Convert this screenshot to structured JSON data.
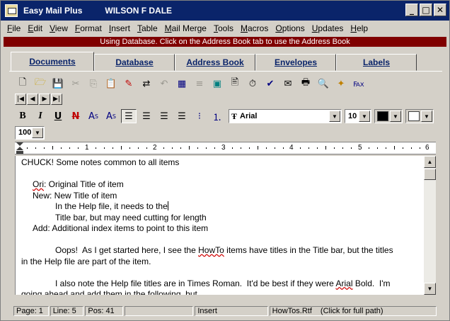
{
  "titlebar": {
    "app_title": "Easy Mail Plus",
    "user_name": "WILSON F DALE",
    "min_label": "_",
    "max_label": "□",
    "close_label": "✕"
  },
  "menu": [
    "File",
    "Edit",
    "View",
    "Format",
    "Insert",
    "Table",
    "Mail Merge",
    "Tools",
    "Macros",
    "Options",
    "Updates",
    "Help"
  ],
  "banner": "Using Database. Click on the Address Book tab to use the Address Book",
  "tabs": [
    "Documents",
    "Database",
    "Address Book",
    "Envelopes",
    "Labels"
  ],
  "toolbar": {
    "nav_first": "|◀",
    "nav_prev": "◀",
    "nav_next": "▶",
    "nav_last": "▶|",
    "bold": "B",
    "italic": "I",
    "underline": "U",
    "normal": "N",
    "superscript": "A",
    "superscript_mark": "S",
    "subscript": "A",
    "subscript_mark": "S",
    "font_name": "Arial",
    "font_size": "10",
    "zoom": "100",
    "fg_color": "#000000",
    "bg_color": "#ffffff"
  },
  "ruler": [
    "1",
    "2",
    "3",
    "4",
    "5",
    "6"
  ],
  "document": {
    "line1": "CHUCK! Some notes common to all items",
    "line3_spell": "Ori",
    "line3_rest": ": Original Title of item",
    "line4": "New: New Title of item",
    "line5": "In the Help file, it needs to the",
    "line6": "Title bar, but may need cutting for length",
    "line7": "Add: Additional index items to point to this item",
    "line9_a": "Oops!  As I get started here, I see the ",
    "line9_spell": "HowTo",
    "line9_b": " items have titles in the Title bar, but the titles",
    "line10": "in the Help file are part of the item.",
    "line12_a": "I also note the Help file titles are in Times Roman.  It'd be best if they were ",
    "line12_spell": "Arial",
    "line12_b": " Bold.  I'm",
    "line13": "going ahead and add them in the following, but"
  },
  "status": {
    "page": "Page: 1",
    "line": "Line: 5",
    "pos": "Pos: 41",
    "blank": "",
    "mode": "Insert",
    "file": "HowTos.Rtf",
    "hint": "(Click for full path)"
  }
}
